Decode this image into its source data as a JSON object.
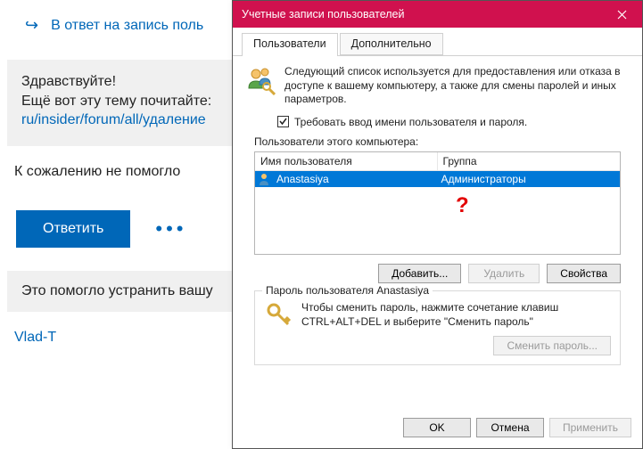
{
  "page": {
    "reply_link_text": "В ответ на запись поль",
    "quote_line1": "Здравствуйте!",
    "quote_line2": "Ещё вот эту тему почитайте:",
    "quote_link": "ru/insider/forum/all/удаление",
    "after_quote": "К сожалению не помогло",
    "reply_button": "Ответить",
    "help_text": "Это помогло устранить вашу",
    "user_link": "Vlad-T"
  },
  "dialog": {
    "title": "Учетные записи пользователей",
    "tabs": {
      "users": "Пользователи",
      "advanced": "Дополнительно"
    },
    "description": "Следующий список используется для предоставления или отказа в доступе к вашему компьютеру, а также для смены паролей и иных параметров.",
    "require_checkbox_label": "Требовать ввод имени пользователя и пароля.",
    "require_checked": true,
    "list_label": "Пользователи этого компьютера:",
    "columns": {
      "username": "Имя пользователя",
      "group": "Группа"
    },
    "rows": [
      {
        "username": "Anastasiya",
        "group": "Администраторы"
      }
    ],
    "annotation": "?",
    "buttons": {
      "add": "Добавить...",
      "remove": "Удалить",
      "props": "Свойства"
    },
    "password_group_legend": "Пароль пользователя Anastasiya",
    "password_hint": "Чтобы сменить пароль, нажмите сочетание клавиш CTRL+ALT+DEL и выберите \"Сменить пароль\"",
    "change_password_btn": "Сменить пароль...",
    "footer": {
      "ok": "OK",
      "cancel": "Отмена",
      "apply": "Применить"
    }
  }
}
